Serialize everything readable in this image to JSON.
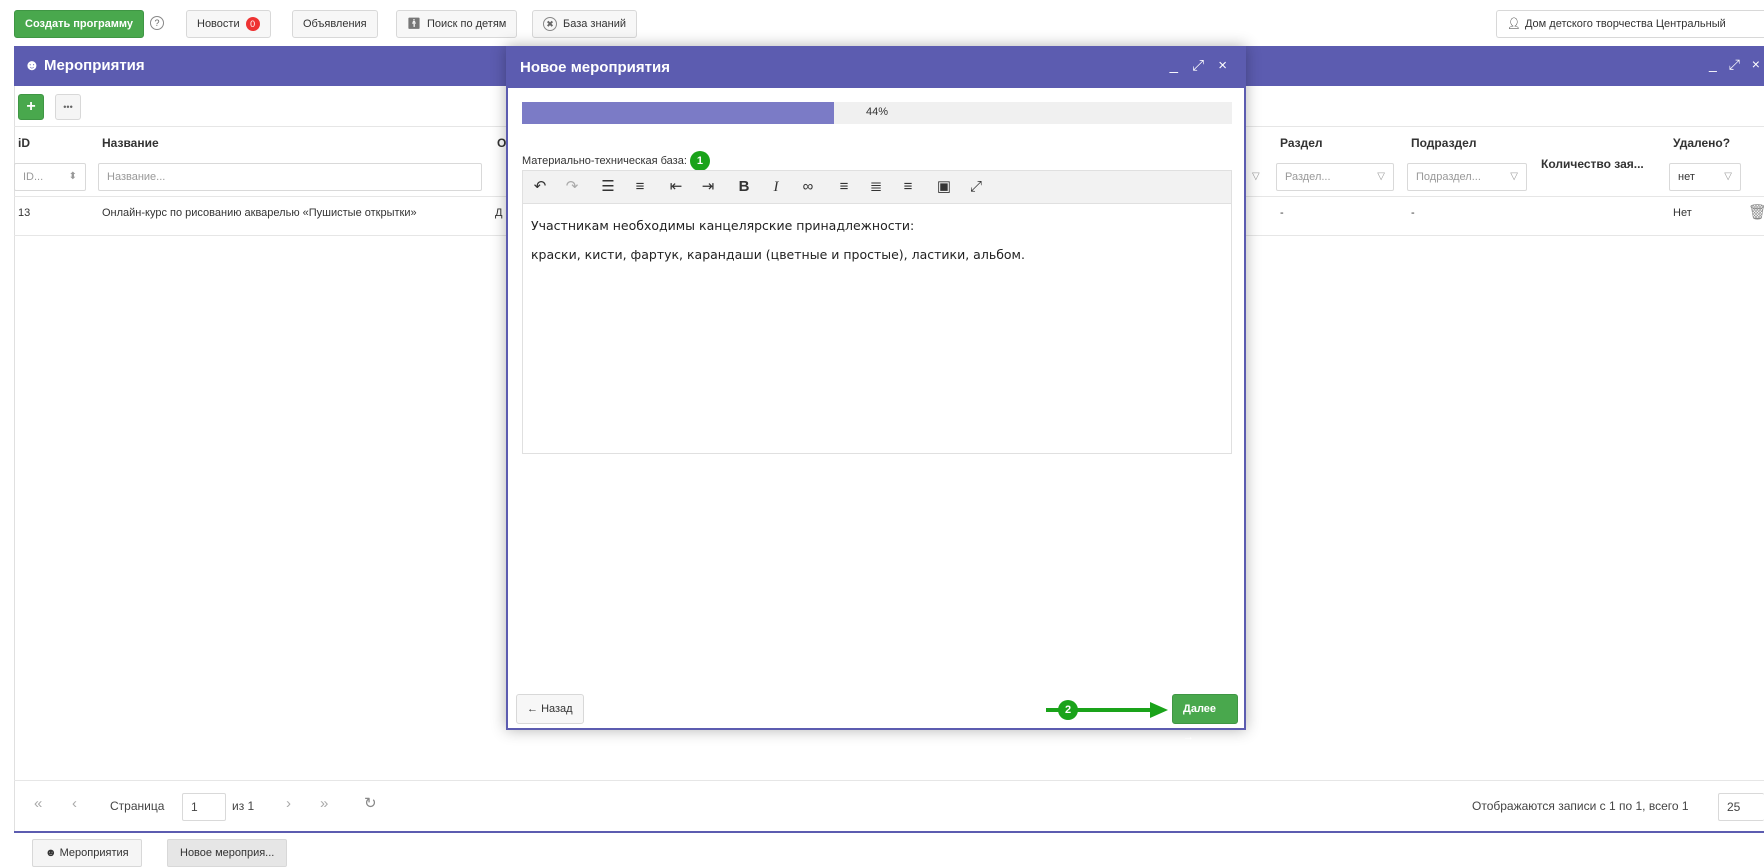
{
  "toolbar": {
    "create_program": "Создать программу",
    "help_icon": "?",
    "news": "Новости",
    "news_count": "0",
    "announcements": "Объявления",
    "child_search": "Поиск по детям",
    "knowledge_base": "База знаний",
    "organization": "Дом детского творчества Центральный"
  },
  "main_window": {
    "title": "Мероприятия",
    "controls": "_ ⤢ ×",
    "add": "+",
    "more": "•••",
    "columns": {
      "id": "iD",
      "name": "Название",
      "o": "О",
      "section": "Раздел",
      "subsection": "Подраздел",
      "applications": "Количество зая...",
      "deleted": "Удалено?"
    },
    "filters": {
      "id_placeholder": "ID...",
      "name_placeholder": "Название...",
      "section_placeholder": "Раздел...",
      "subsection_placeholder": "Подраздел...",
      "deleted_value": "нет"
    },
    "rows": [
      {
        "id": "13",
        "name": "Онлайн-курс по рисованию акварелью «Пушистые открытки»",
        "o": "Д",
        "section": "-",
        "subsection": "-",
        "deleted": "Нет"
      }
    ]
  },
  "pager": {
    "page_label": "Страница",
    "page_value": "1",
    "of_label": "из 1",
    "records": "Отображаются записи с 1 по 1, всего 1",
    "per_page": "25"
  },
  "taskbar": {
    "events": "Мероприятия",
    "new_event": "Новое мероприя..."
  },
  "modal": {
    "title": "Новое мероприятия",
    "controls": "_ ⤢ ×",
    "progress_percent": 44,
    "progress_text": "44%",
    "field_label": "Материально-техническая база:",
    "step1": "1",
    "step2": "2",
    "editor_line1": "Участникам необходимы канцелярские принадлежности:",
    "editor_line2": "краски, кисти, фартук, карандаши (цветные и простые), ластики, альбом.",
    "back": "Назад",
    "next": "Далее",
    "accent_color": "#5c5cb0",
    "success_color": "#49a84d"
  }
}
